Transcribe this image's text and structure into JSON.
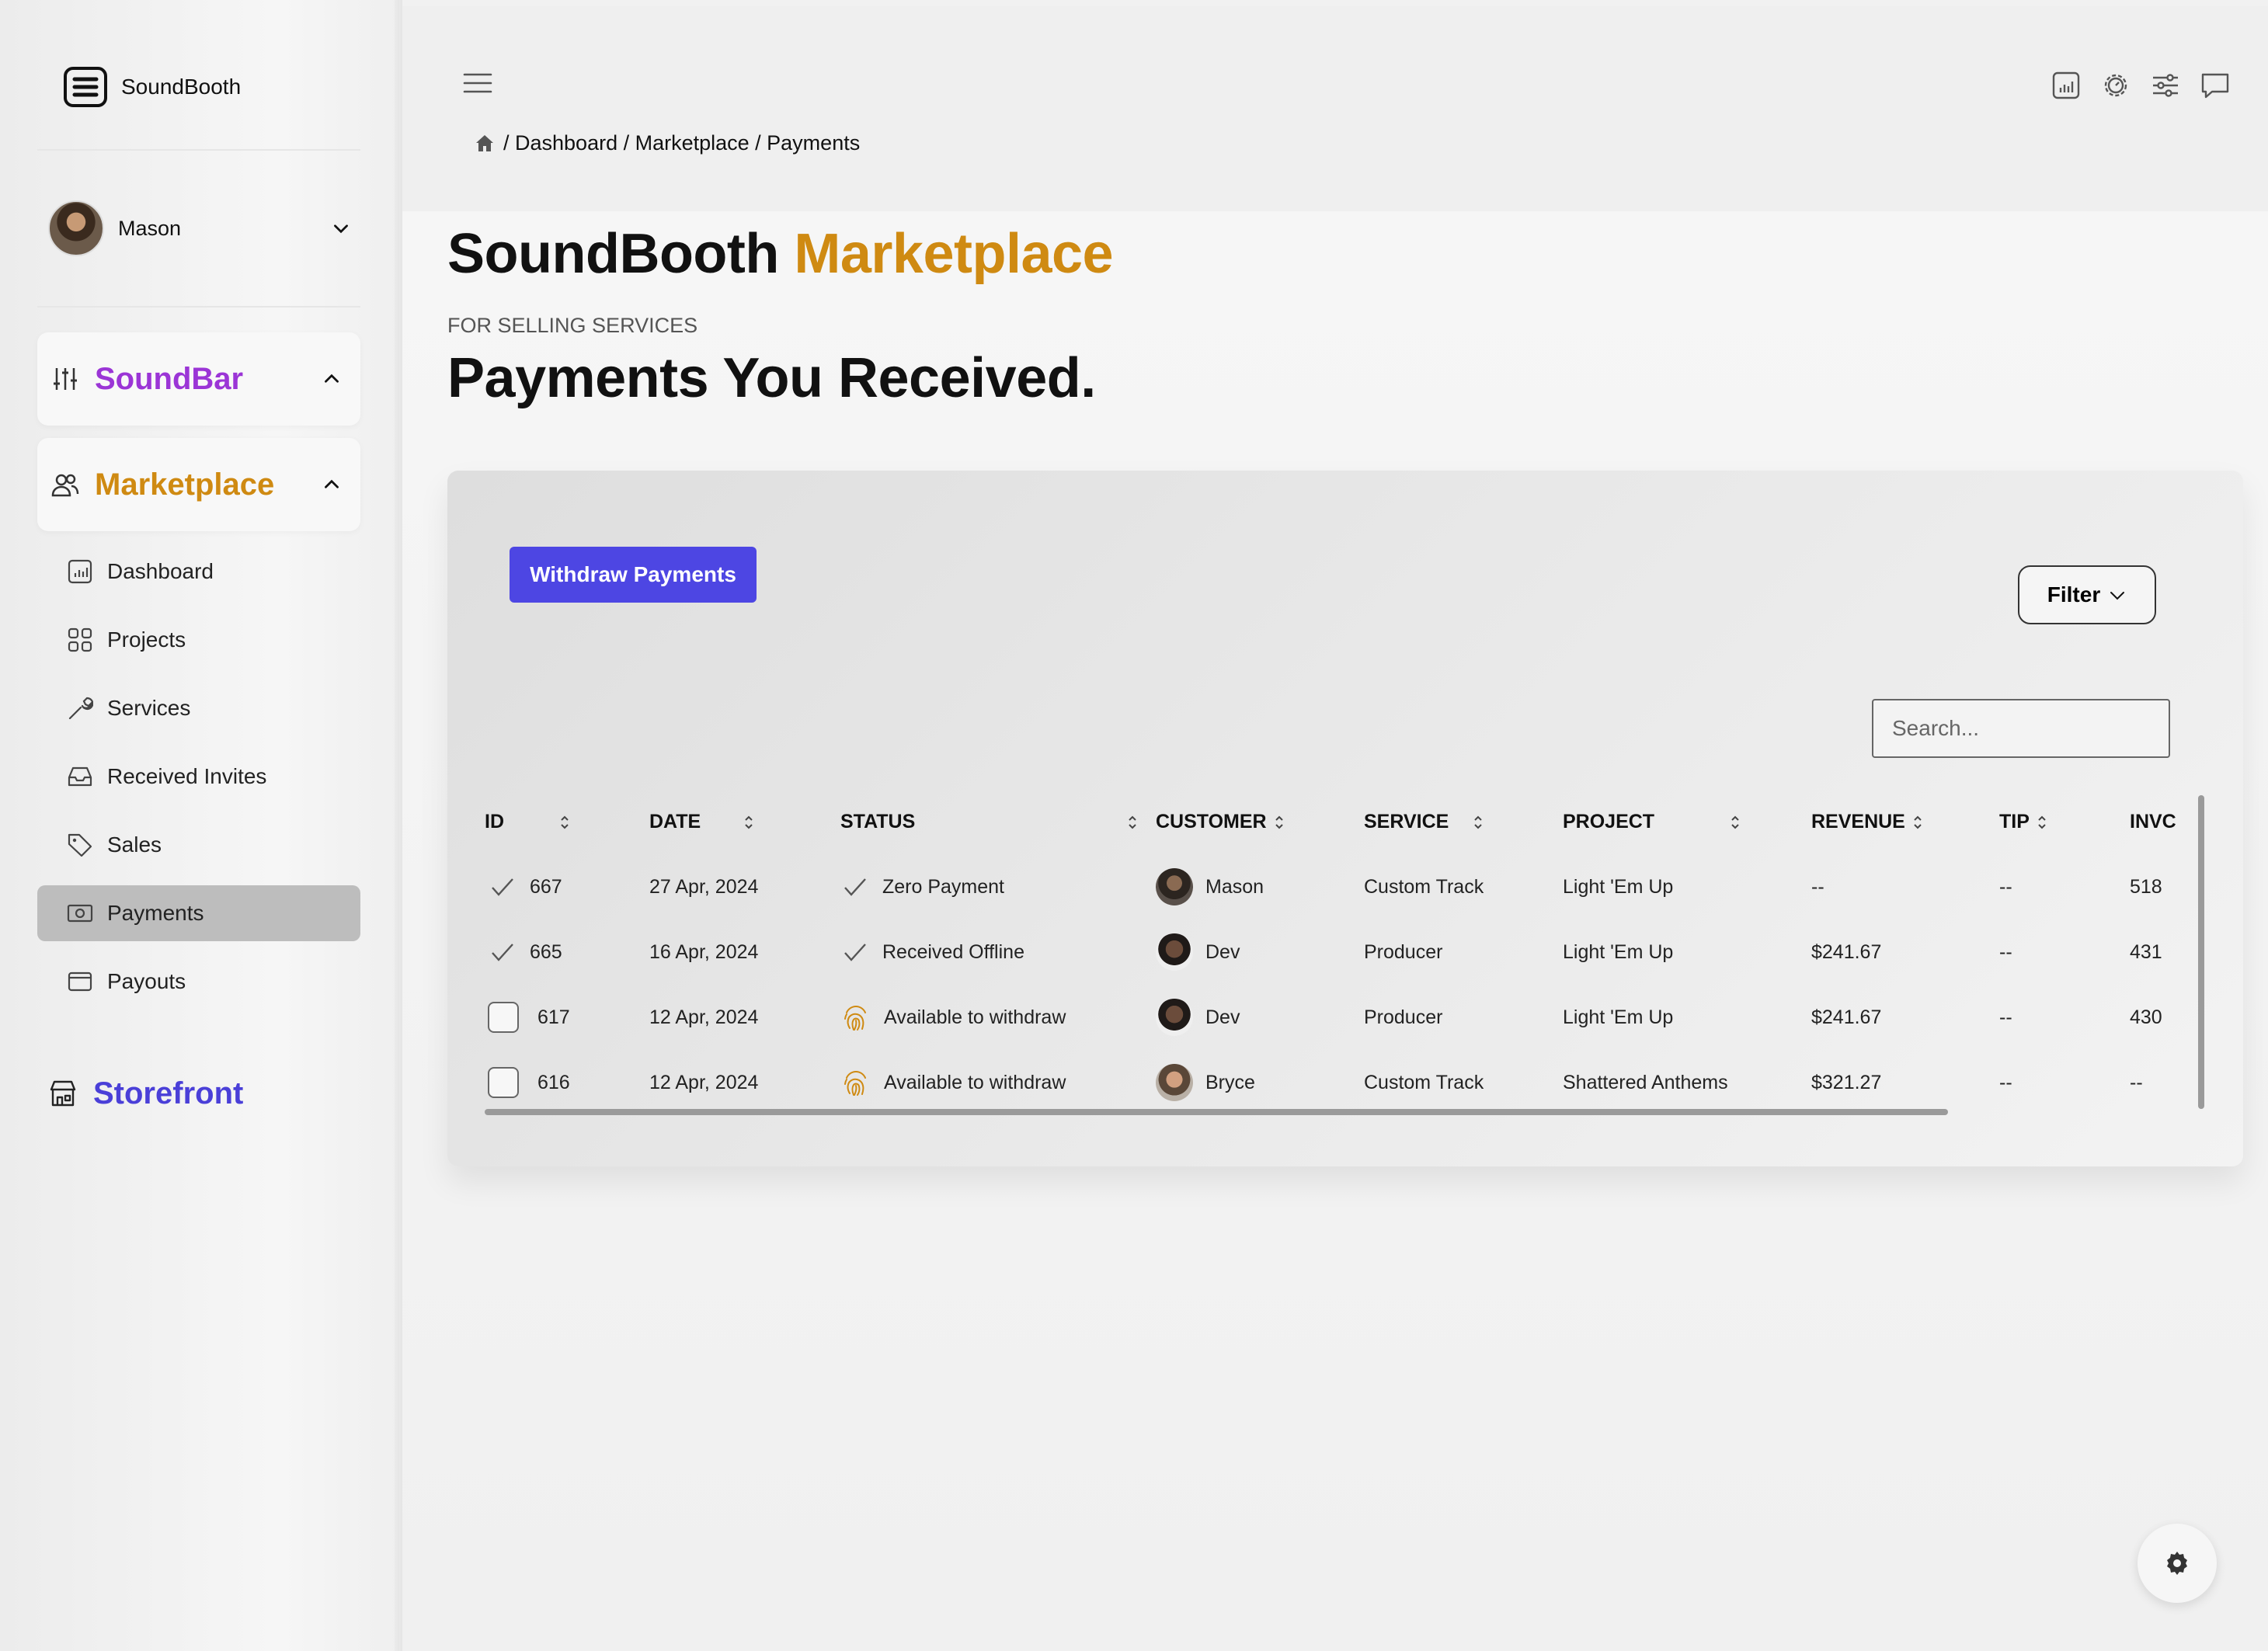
{
  "app": {
    "name": "SoundBooth"
  },
  "user": {
    "name": "Mason"
  },
  "sidebar": {
    "sections": [
      {
        "title": "SoundBar",
        "color": "#9b35d6",
        "icon": "sliders-icon"
      },
      {
        "title": "Marketplace",
        "color": "#cf8a12",
        "icon": "users-icon"
      }
    ],
    "items": [
      {
        "label": "Dashboard",
        "icon": "chart-icon"
      },
      {
        "label": "Projects",
        "icon": "grid-icon"
      },
      {
        "label": "Services",
        "icon": "wrench-icon"
      },
      {
        "label": "Received Invites",
        "icon": "inbox-icon"
      },
      {
        "label": "Sales",
        "icon": "tag-icon"
      },
      {
        "label": "Payments",
        "icon": "cash-icon",
        "active": true
      },
      {
        "label": "Payouts",
        "icon": "wallet-icon"
      }
    ],
    "storefront": {
      "title": "Storefront",
      "color": "#4a3fd8",
      "icon": "store-icon"
    }
  },
  "breadcrumb": {
    "text": "/ Dashboard / Marketplace / Payments"
  },
  "page": {
    "title_main": "SoundBooth",
    "title_accent": "Marketplace",
    "subtitle_small": "FOR SELLING SERVICES",
    "subtitle_big": "Payments You Received."
  },
  "actions": {
    "withdraw_label": "Withdraw Payments",
    "filter_label": "Filter",
    "search_placeholder": "Search..."
  },
  "colors": {
    "accent": "#cf8a12",
    "brand_blue": "#4d46e3",
    "soundbar_purple": "#9b35d6"
  },
  "table": {
    "headers": {
      "id": "ID",
      "date": "DATE",
      "status": "STATUS",
      "customer": "CUSTOMER",
      "service": "SERVICE",
      "project": "PROJECT",
      "revenue": "REVENUE",
      "tip": "TIP",
      "invoice": "INVC"
    },
    "rows": [
      {
        "id": "667",
        "date": "27 Apr, 2024",
        "status": "Zero Payment",
        "customer": "Mason",
        "service": "Custom Track",
        "project": "Light 'Em Up",
        "revenue": "--",
        "tip": "--",
        "invoice": "518"
      },
      {
        "id": "665",
        "date": "16 Apr, 2024",
        "status": "Received Offline",
        "customer": "Dev",
        "service": "Producer",
        "project": "Light 'Em Up",
        "revenue": "$241.67",
        "tip": "--",
        "invoice": "431"
      },
      {
        "id": "617",
        "date": "12 Apr, 2024",
        "status": "Available to withdraw",
        "customer": "Dev",
        "service": "Producer",
        "project": "Light 'Em Up",
        "revenue": "$241.67",
        "tip": "--",
        "invoice": "430"
      },
      {
        "id": "616",
        "date": "12 Apr, 2024",
        "status": "Available to withdraw",
        "customer": "Bryce",
        "service": "Custom Track",
        "project": "Shattered Anthems",
        "revenue": "$321.27",
        "tip": "--",
        "invoice": "--"
      }
    ]
  }
}
